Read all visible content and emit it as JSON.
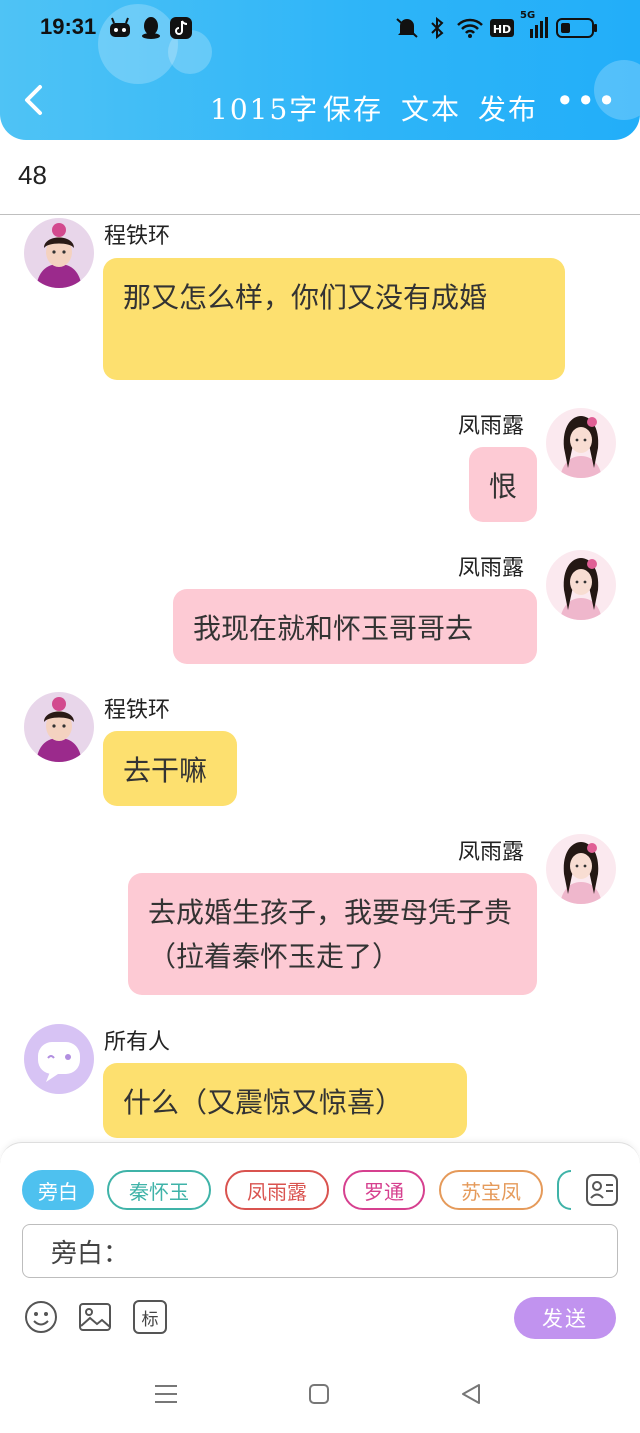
{
  "status_bar": {
    "time": "19:31",
    "network": "5G"
  },
  "toolbar": {
    "word_count": "1015字",
    "save": "保存",
    "text": "文本",
    "publish": "发布",
    "more": "•••"
  },
  "chapter": {
    "number": "48"
  },
  "messages": [
    {
      "side": "left",
      "speaker": "程铁环",
      "text": "那又怎么样，你们又没有成婚",
      "color": "#fde06f"
    },
    {
      "side": "right",
      "speaker": "凤雨露",
      "text": "恨",
      "color": "#fdcad4"
    },
    {
      "side": "right",
      "speaker": "凤雨露",
      "text": "我现在就和怀玉哥哥去",
      "color": "#fdcad4"
    },
    {
      "side": "left",
      "speaker": "程铁环",
      "text": "去干嘛",
      "color": "#fde06f"
    },
    {
      "side": "right",
      "speaker": "凤雨露",
      "text": "去成婚生孩子，我要母凭子贵（拉着秦怀玉走了）",
      "color": "#fdcad4"
    },
    {
      "side": "left",
      "speaker": "所有人",
      "text": "什么（又震惊又惊喜）",
      "color": "#fde06f"
    }
  ],
  "roles": [
    {
      "label": "旁白",
      "color": "#4ec1ef",
      "active": true
    },
    {
      "label": "秦怀玉",
      "color": "#3fb3a8"
    },
    {
      "label": "凤雨露",
      "color": "#d9534f"
    },
    {
      "label": "罗通",
      "color": "#d6408f"
    },
    {
      "label": "苏宝凤",
      "color": "#e59a5a"
    }
  ],
  "input": {
    "value": "旁白："
  },
  "tools": {
    "mark": "标"
  },
  "send_label": "发送"
}
